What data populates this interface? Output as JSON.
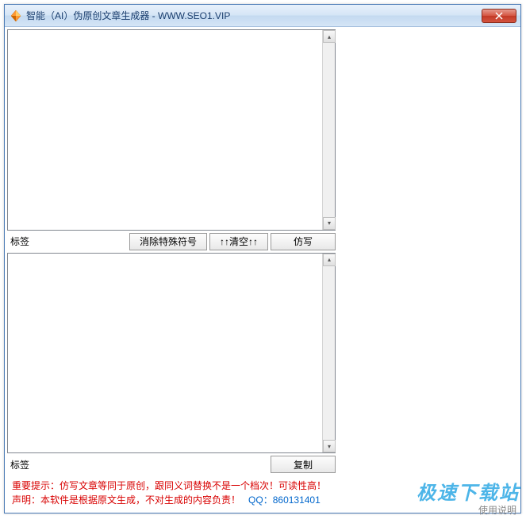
{
  "window": {
    "title": "智能（AI）伪原创文章生成器 - WWW.SEO1.VIP"
  },
  "input_section": {
    "label": "标签",
    "textarea_value": "",
    "btn_remove_special": "消除特殊符号",
    "btn_clear": "↑↑清空↑↑",
    "btn_rewrite": "仿写"
  },
  "output_section": {
    "label": "标签",
    "textarea_value": "",
    "btn_copy": "复制"
  },
  "notice": {
    "line1_prefix": "重要提示：",
    "line1_text": "仿写文章等同于原创，跟同义词替换不是一个档次！可读性高！",
    "line2_prefix": "声明：",
    "line2_text": "本软件是根据原文生成，不对生成的内容负责！",
    "qq_label": "QQ：",
    "qq_number": "860131401"
  },
  "watermark": {
    "main": "极速下载站",
    "sub": "使用说明"
  }
}
